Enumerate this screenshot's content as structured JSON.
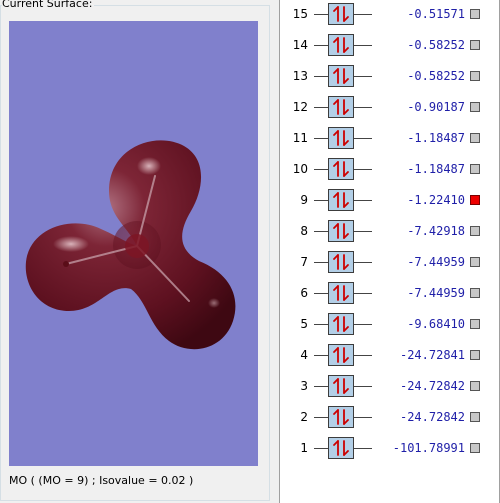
{
  "surface_panel": {
    "label": "Current Surface:",
    "status": "MO ( (MO = 9) ; Isovalue = 0.02 )",
    "background_color": "#8080cc",
    "surface_color": "#6e1a2a"
  },
  "orbitals": [
    {
      "index": "15",
      "energy": "-0.51571",
      "selected": false
    },
    {
      "index": "14",
      "energy": "-0.58252",
      "selected": false
    },
    {
      "index": "13",
      "energy": "-0.58252",
      "selected": false
    },
    {
      "index": "12",
      "energy": "-0.90187",
      "selected": false
    },
    {
      "index": "11",
      "energy": "-1.18487",
      "selected": false
    },
    {
      "index": "10",
      "energy": "-1.18487",
      "selected": false
    },
    {
      "index": "9",
      "energy": "-1.22410",
      "selected": true
    },
    {
      "index": "8",
      "energy": "-7.42918",
      "selected": false
    },
    {
      "index": "7",
      "energy": "-7.44959",
      "selected": false
    },
    {
      "index": "6",
      "energy": "-7.44959",
      "selected": false
    },
    {
      "index": "5",
      "energy": "-9.68410",
      "selected": false
    },
    {
      "index": "4",
      "energy": "-24.72841",
      "selected": false
    },
    {
      "index": "3",
      "energy": "-24.72842",
      "selected": false
    },
    {
      "index": "2",
      "energy": "-24.72842",
      "selected": false
    },
    {
      "index": "1",
      "energy": "-101.78991",
      "selected": false
    }
  ],
  "orbital_occupancy_icon": "up-down-arrow-pair",
  "colors": {
    "orbital_box": "#b3cfe7",
    "electron_arrow": "#cc0000",
    "energy_text": "#1f1fa8",
    "selected_marker": "#ee0000",
    "unselected_marker": "#c8c8c8"
  }
}
